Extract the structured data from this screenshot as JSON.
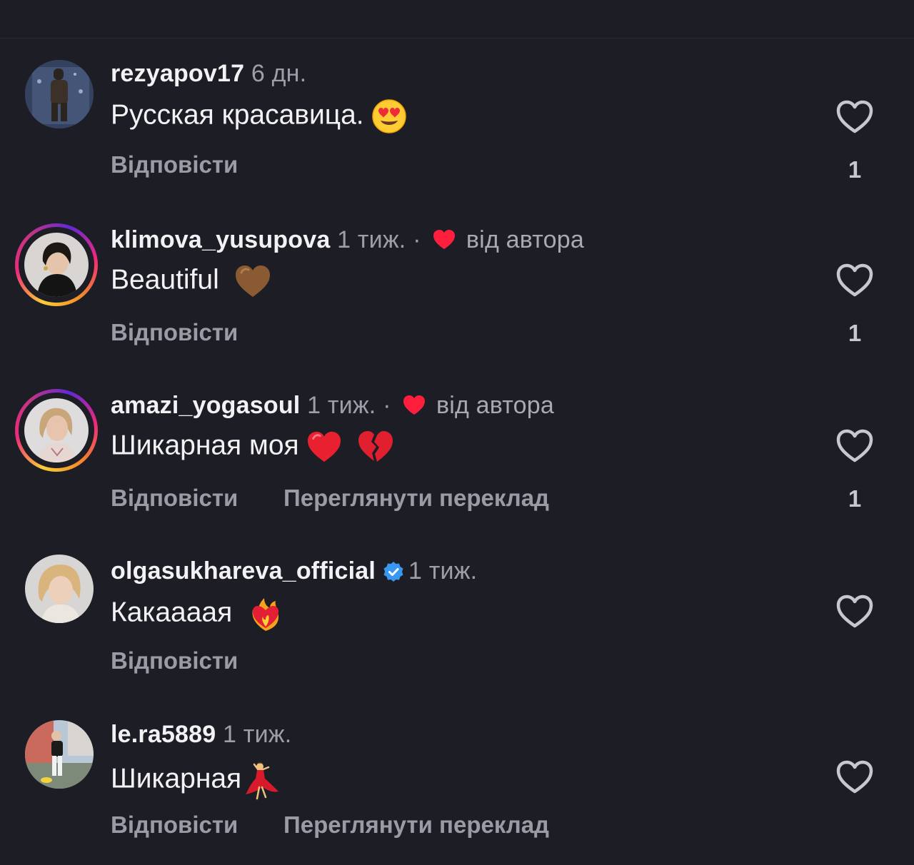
{
  "comments": [
    {
      "username": "rezyapov17",
      "time": "6 дн.",
      "text": "Русская красавица.",
      "emoji": "heart-eyes-emoji",
      "reply": "Відповісти",
      "likes": "1",
      "story_ring": false,
      "liked_by_author": false
    },
    {
      "username": "klimova_yusupova",
      "time": "1 тиж.",
      "separator": "·",
      "author_label": "від автора",
      "text": "Beautiful",
      "emoji": "brown-heart-emoji",
      "reply": "Відповісти",
      "likes": "1",
      "story_ring": true,
      "liked_by_author": true
    },
    {
      "username": "amazi_yogasoul",
      "time": "1 тиж.",
      "separator": "·",
      "author_label": "від автора",
      "text": "Шикарная моя",
      "emoji": "red-heart-and-broken-heart-emoji",
      "reply": "Відповісти",
      "translate": "Переглянути переклад",
      "likes": "1",
      "story_ring": true,
      "liked_by_author": true
    },
    {
      "username": "olgasukhareva_official",
      "verified": true,
      "time": "1 тиж.",
      "text": "Какаааая",
      "emoji": "heart-on-fire-emoji",
      "reply": "Відповісти",
      "story_ring": false
    },
    {
      "username": "le.ra5889",
      "time": "1 тиж.",
      "text": "Шикарная",
      "emoji": "dancer-emoji",
      "reply": "Відповісти",
      "translate": "Переглянути переклад",
      "story_ring": false
    }
  ],
  "colors": {
    "background": "#1d1e25",
    "username": "#f2f2f4",
    "meta": "#9d9ea7",
    "author_heart": "#ff1f3d",
    "verified": "#3897f0",
    "like_icon": "#c7c8cf"
  }
}
